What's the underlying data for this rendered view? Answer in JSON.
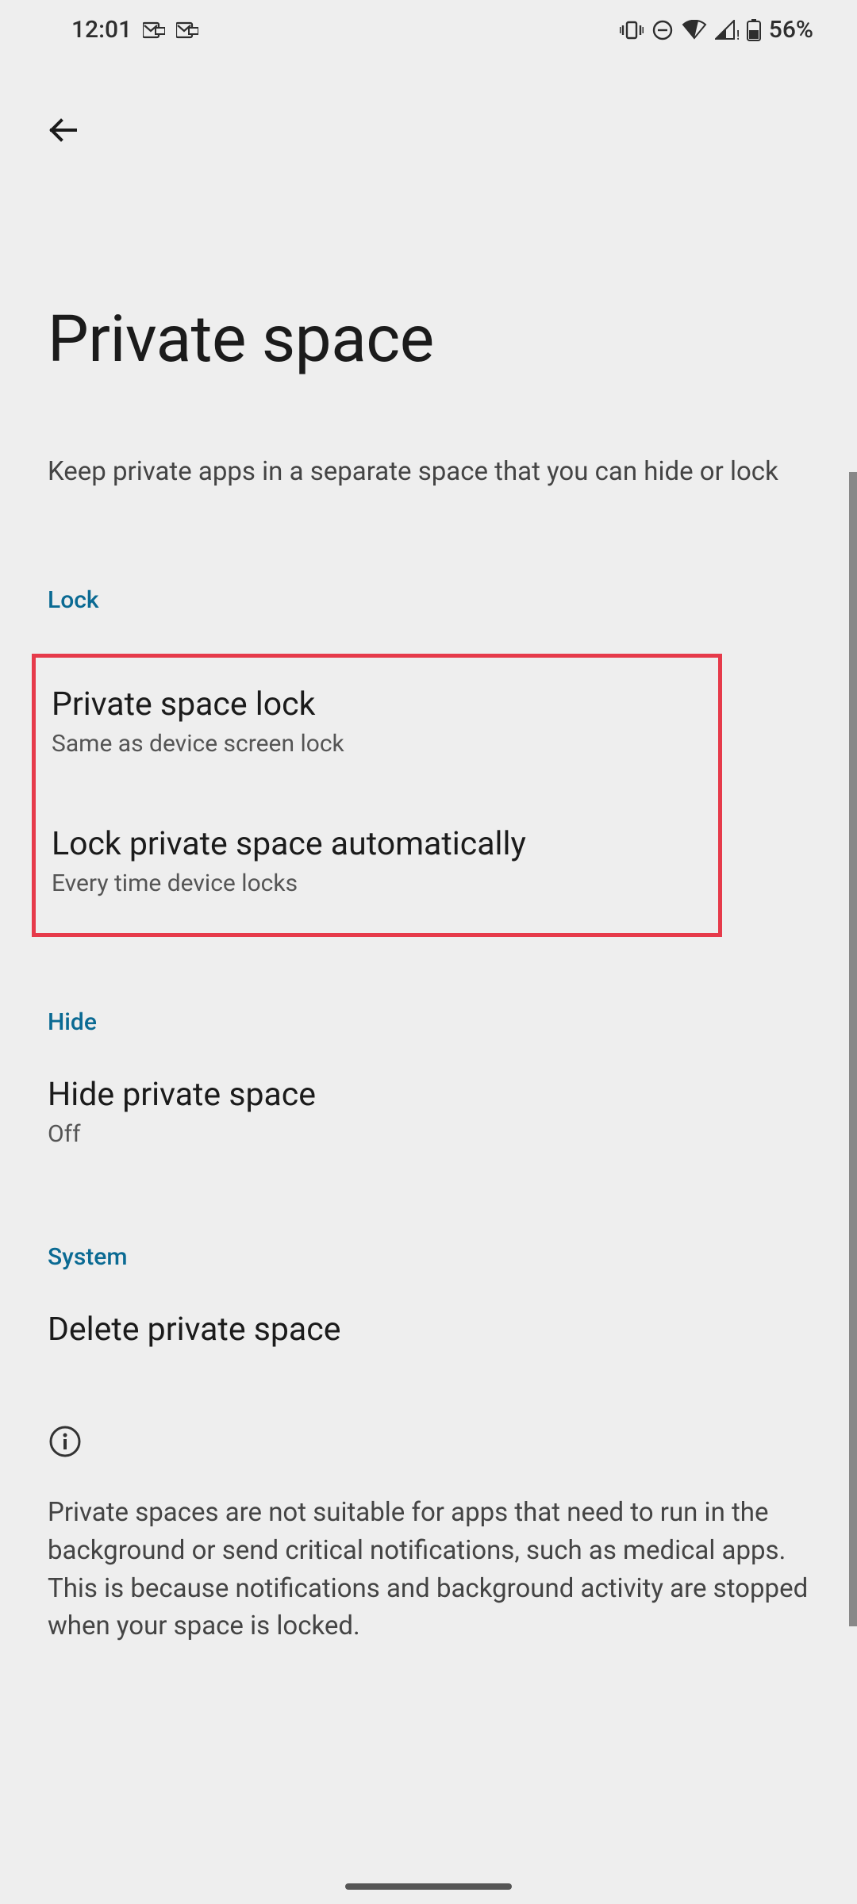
{
  "status_bar": {
    "time": "12:01",
    "battery_pct": "56%"
  },
  "page": {
    "title": "Private space",
    "subtitle": "Keep private apps in a separate space that you can hide or lock"
  },
  "sections": {
    "lock": {
      "header": "Lock",
      "items": [
        {
          "title": "Private space lock",
          "subtitle": "Same as device screen lock"
        },
        {
          "title": "Lock private space automatically",
          "subtitle": "Every time device locks"
        }
      ]
    },
    "hide": {
      "header": "Hide",
      "item": {
        "title": "Hide private space",
        "subtitle": "Off"
      }
    },
    "system": {
      "header": "System",
      "item": {
        "title": "Delete private space"
      }
    }
  },
  "info": {
    "text": "Private spaces are not suitable for apps that need to run in the background or send critical notifications, such as medical apps. This is because notifications and background activity are stopped when your space is locked."
  }
}
